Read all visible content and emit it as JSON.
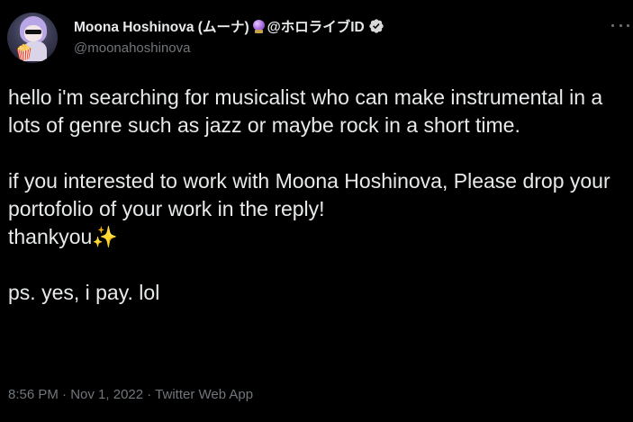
{
  "author": {
    "display_name": "Moona Hoshinova (ムーナ)",
    "name_suffix": "@ホロライブID",
    "handle": "@moonahoshinova",
    "name_emoji_icon": "crystal-ball-icon",
    "verified_icon": "verified-badge-icon"
  },
  "tweet": {
    "paragraphs": [
      "hello i'm searching for musicalist who can make instrumental in a lots of genre such as jazz or maybe rock in a short time.",
      "if you interested to work with Moona Hoshinova, Please drop your portofolio of your work in the reply!\nthankyou✨",
      "ps. yes, i pay. lol"
    ]
  },
  "meta": {
    "time": "8:56 PM",
    "date": "Nov 1, 2022",
    "source": "Twitter Web App"
  },
  "colors": {
    "background": "#000000",
    "primary_text": "#e7e9ea",
    "secondary_text": "#71767b"
  }
}
